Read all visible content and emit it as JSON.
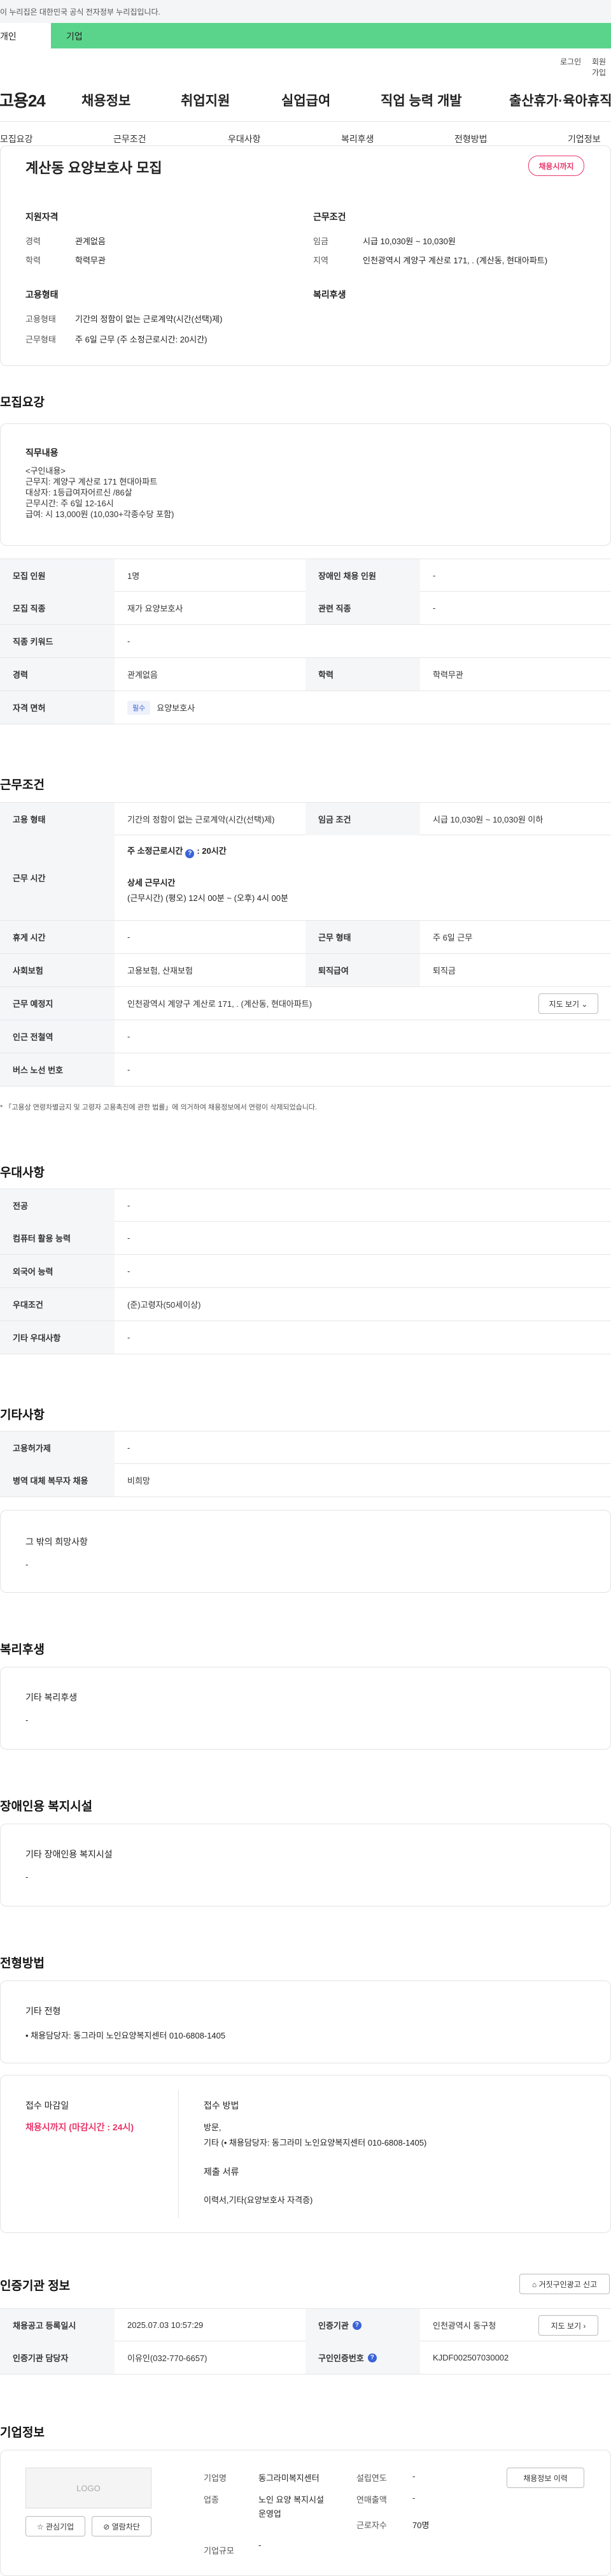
{
  "banner": {
    "text": "이 누리집은 대한민국 공식 전자정부 누리집입니다."
  },
  "tabs": [
    "개인",
    "기업"
  ],
  "util": [
    "로그인",
    "회원가입"
  ],
  "gnb": {
    "logo": "고용24",
    "menu": [
      "채용정보",
      "취업지원",
      "실업급여",
      "직업 능력 개발",
      "출산휴가·육아휴직"
    ]
  },
  "subnav": [
    "모집요강",
    "근무조건",
    "우대사항",
    "복리후생",
    "전형방법",
    "기업정보"
  ],
  "summary": {
    "title": "계산동 요양보호사 모집",
    "badge": "채용시까지",
    "qual_h": "지원자격",
    "cond_h": "근무조건",
    "qual": [
      [
        "경력",
        "관계없음"
      ],
      [
        "학력",
        "학력무관"
      ]
    ],
    "cond": [
      [
        "임금",
        "시급 10,030원 ~ 10,030원"
      ],
      [
        "지역",
        "인천광역시 계양구 계산로 171, . (계산동, 현대아파트)"
      ]
    ],
    "emp_h": "고용형태",
    "welf_h": "복리후생",
    "emp": [
      [
        "고용형태",
        "기간의 정함이 없는 근로계약(시간(선택)제)"
      ],
      [
        "근무형태",
        "주 6일 근무 (주 소정근로시간: 20시간)"
      ]
    ]
  },
  "req": {
    "title": "모집요강",
    "job_h": "직무내용",
    "job_lines": [
      "<구인내용>",
      "근무지: 계양구 계산로 171 현대아파트",
      "대상자: 1등급여자어르신 /86살",
      "근무시간: 주 6일 12-16시",
      "급여: 시 13,000원 (10,030+각종수당 포함)"
    ],
    "rows": [
      [
        "모집 인원",
        "1명",
        "장애인 채용 인원",
        "-"
      ],
      [
        "모집 직종",
        "재가 요양보호사",
        "관련 직종",
        "-"
      ],
      [
        "직종 키워드",
        "-"
      ],
      [
        "경력",
        "관계없음",
        "학력",
        "학력무관"
      ]
    ],
    "lic_label": "자격 면허",
    "lic_tag": "필수",
    "lic_val": "요양보호사"
  },
  "work": {
    "title": "근무조건",
    "r1": [
      "고용 형태",
      "기간의 정함이 없는 근로계약(시간(선택)제)",
      "임금 조건",
      "시급 10,030원 ~ 10,030원 이하"
    ],
    "hours_label": "근무 시간",
    "hours_week": "주 소정근로시간",
    "hours_val": ": 20시간",
    "detail_h": "상세 근무시간",
    "detail_v": "(근무시간) (평오) 12시 00분 ~ (오후) 4시 00분",
    "r3": [
      "휴게 시간",
      "-",
      "근무 형태",
      "주 6일 근무"
    ],
    "r4": [
      "사회보험",
      "고용보험, 산재보험",
      "퇴직급여",
      "퇴직금"
    ],
    "place_label": "근무 예정지",
    "place": "인천광역시 계양구 계산로 171, . (계산동, 현대아파트)",
    "map_btn": "지도 보기",
    "r6": [
      "인근 전철역",
      "-"
    ],
    "r7": [
      "버스 노선 번호",
      "-"
    ],
    "note": "* 「고용상 연령차별금지 및 고령자 고용촉진에 관한 법률」에 의거하여 채용정보에서 연령이 삭제되었습니다."
  },
  "pref": {
    "title": "우대사항",
    "rows": [
      [
        "전공",
        "-"
      ],
      [
        "컴퓨터 활용 능력",
        "-"
      ],
      [
        "외국어 능력",
        "-"
      ],
      [
        "우대조건",
        "(준)고령자(50세이상)"
      ],
      [
        "기타 우대사항",
        "-"
      ]
    ]
  },
  "etc": {
    "title": "기타사항",
    "rows": [
      [
        "고용허가제",
        "-"
      ],
      [
        "병역 대체 복무자 채용",
        "비희망"
      ]
    ],
    "box_h": "그 밖의 희망사항",
    "box_v": "-"
  },
  "welfare": {
    "title": "복리후생",
    "box_h": "기타 복리후생",
    "box_v": "-"
  },
  "dis": {
    "title": "장애인용 복지시설",
    "box_h": "기타 장애인용 복지시설",
    "box_v": "-"
  },
  "sel": {
    "title": "전형방법",
    "etc_h": "기타 전형",
    "etc_v": "• 채용담당자: 동그라미 노인요양복지센터 010-6808-1405",
    "deadline_h": "접수 마감일",
    "deadline_v": "채용시까지 (마감시간 : 24시)",
    "method_h": "접수 방법",
    "method_v1": "방문,",
    "method_v2": "기타 (• 채용담당자: 동그라미 노인요양복지센터 010-6808-1405)",
    "docs_h": "제출 서류",
    "docs_v": "이력서,기타(요양보호사 자격증)"
  },
  "cert": {
    "title": "인증기관 정보",
    "report_btn": "거짓구인광고 신고",
    "rows": [
      [
        "채용공고 등록일시",
        "2025.07.03 10:57:29",
        "인증기관",
        "인천광역시 동구청"
      ],
      [
        "인증기관 담당자",
        "이유인(032-770-6657)",
        "구인인증번호",
        "KJDF002507030002"
      ]
    ],
    "map_btn": "지도 보기"
  },
  "company": {
    "title": "기업정보",
    "logo": "LOGO",
    "fav": "관심기업",
    "block": "열람차단",
    "labels": [
      "기업명",
      "업종",
      "기업규모",
      "설립연도",
      "연매출액",
      "근로자수"
    ],
    "values": [
      "동그라미복지센터",
      "노인 요양 복지시설 운영업",
      "-",
      "-",
      "-",
      "70명"
    ],
    "hist_btn": "채용정보 이력"
  }
}
